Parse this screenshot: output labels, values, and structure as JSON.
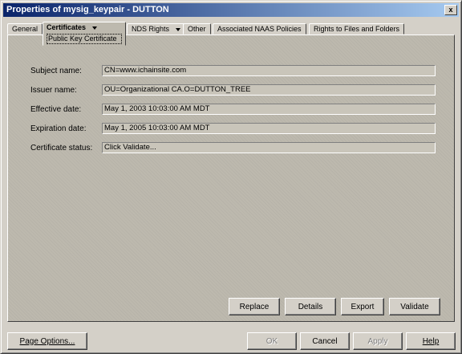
{
  "window": {
    "title": "Properties of mysig_keypair - DUTTON",
    "close_label": "x"
  },
  "tabs": [
    {
      "label": "General"
    },
    {
      "label": "Certificates",
      "sub": "Public Key Certificate"
    },
    {
      "label": "NDS Rights"
    },
    {
      "label": "Other"
    },
    {
      "label": "Associated NAAS Policies"
    },
    {
      "label": "Rights to Files and Folders"
    }
  ],
  "fields": [
    {
      "label": "Subject name:",
      "value": "CN=www.ichainsite.com"
    },
    {
      "label": "Issuer name:",
      "value": "OU=Organizational CA.O=DUTTON_TREE"
    },
    {
      "label": "Effective date:",
      "value": "May 1, 2003 10:03:00 AM MDT"
    },
    {
      "label": "Expiration date:",
      "value": "May 1, 2005 10:03:00 AM MDT"
    },
    {
      "label": "Certificate status:",
      "value": "Click Validate..."
    }
  ],
  "panel_buttons": {
    "replace": "Replace",
    "details": "Details",
    "export": "Export",
    "validate": "Validate"
  },
  "footer": {
    "page_options": "Page Options...",
    "ok": "OK",
    "cancel": "Cancel",
    "apply": "Apply",
    "help": "Help"
  }
}
